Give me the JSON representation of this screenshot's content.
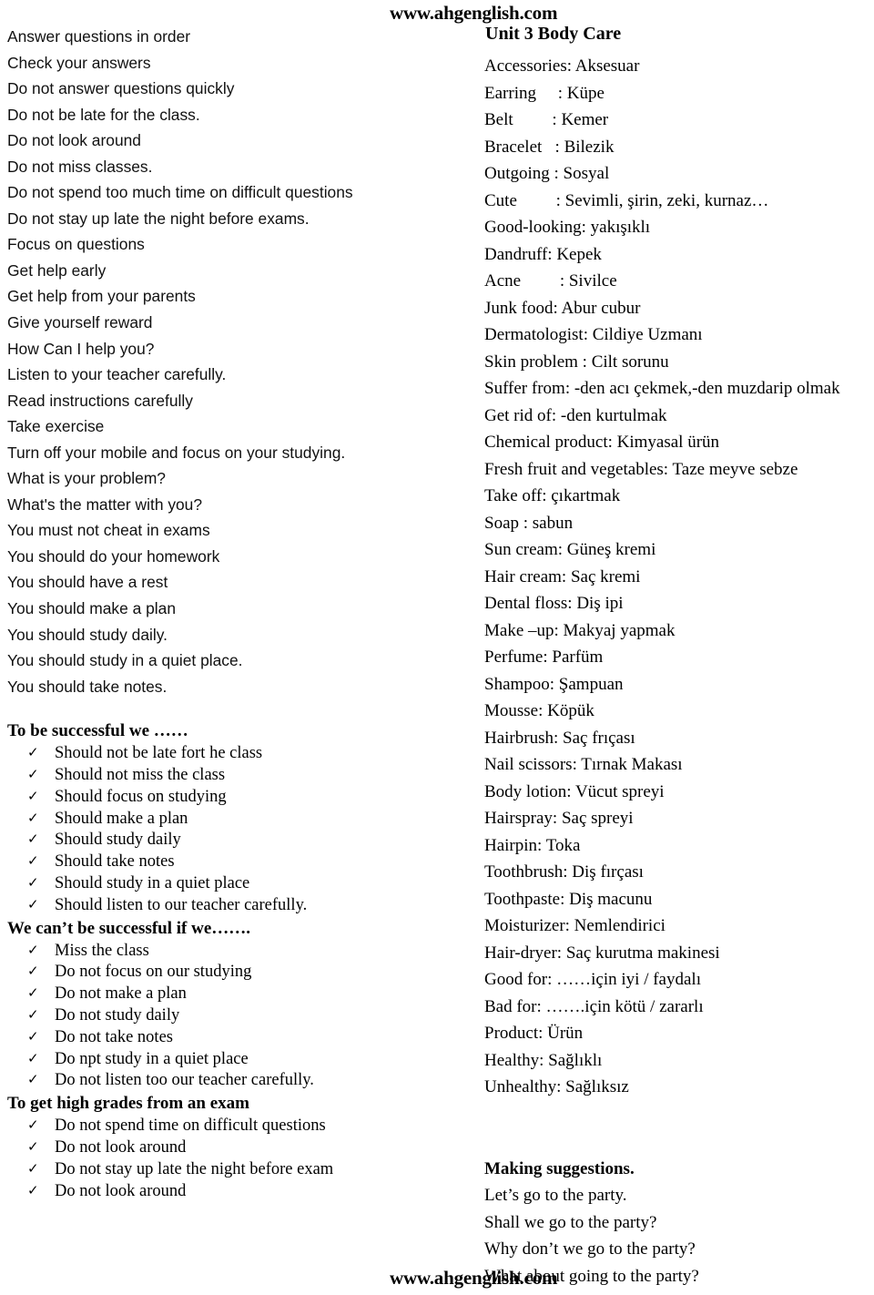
{
  "header": {
    "site_url": "www.ahgenglish.com",
    "unit_title": "Unit 3 Body Care"
  },
  "footer": {
    "site_url": "www.ahgenglish.com"
  },
  "left_column": {
    "phrase_lines": [
      "Answer questions in order",
      "Check your answers",
      "Do not answer questions quickly",
      "Do not be late for the class.",
      "Do not look around",
      "Do not miss classes.",
      "Do not spend too much time on difficult questions",
      "Do not stay up late the night before exams.",
      "Focus on questions",
      "Get help early",
      "Get help from your parents",
      "Give yourself reward",
      "How Can I help you?",
      "Listen to your teacher carefully.",
      "Read instructions carefully",
      "Take exercise",
      "Turn off your mobile and focus on your studying.",
      "What is your problem?",
      "What's the matter with you?",
      "You must not cheat in exams",
      "You should do your homework",
      "You should have a rest",
      "You should make a plan",
      "You should study daily.",
      "You should study in a quiet place.",
      "You should take notes."
    ],
    "sections": [
      {
        "heading": "To be successful we ……",
        "items": [
          "Should not be late fort he class",
          "Should not miss the class",
          "Should focus on studying",
          "Should make a plan",
          "Should study daily",
          "Should take notes",
          "Should study in a quiet place",
          "Should listen to our teacher carefully."
        ]
      },
      {
        "heading": "We can’t be successful if we…….",
        "items": [
          "Miss the class",
          "Do not focus on our studying",
          "Do not make a plan",
          "Do not study daily",
          "Do not take notes",
          "Do npt study in a quiet place",
          "Do not listen too our teacher carefully."
        ]
      },
      {
        "heading": "To get high grades from an exam",
        "items": [
          "Do not spend time on difficult questions",
          "Do not look around",
          "Do not stay up late the night before exam",
          "Do not look around"
        ]
      }
    ],
    "tick_glyph": "✓"
  },
  "right_column": {
    "vocabulary": [
      "Accessories: Aksesuar",
      "Earring  : Küpe",
      "Belt   : Kemer",
      "Bracelet  : Bilezik",
      "Outgoing  : Sosyal",
      "Cute   : Sevimli, şirin, zeki, kurnaz…",
      "Good-looking: yakışıklı",
      "Dandruff: Kepek",
      "Acne   : Sivilce",
      "Junk food: Abur cubur",
      "Dermatologist: Cildiye Uzmanı",
      "Skin problem : Cilt sorunu",
      "Suffer from: -den acı çekmek,-den muzdarip olmak",
      "Get rid of: -den kurtulmak",
      "Chemical product: Kimyasal ürün",
      "Fresh fruit and vegetables: Taze meyve sebze",
      "Take off: çıkartmak",
      "Soap : sabun",
      "Sun cream: Güneş kremi",
      "Hair cream: Saç kremi",
      "Dental floss: Diş ipi",
      "Make –up: Makyaj yapmak",
      "Perfume: Parfüm",
      "Shampoo: Şampuan",
      "Mousse: Köpük",
      "Hairbrush: Saç frıçası",
      "Nail scissors: Tırnak Makası",
      "Body lotion: Vücut spreyi",
      "Hairspray: Saç spreyi",
      "Hairpin: Toka",
      "Toothbrush: Diş fırçası",
      "Toothpaste: Diş macunu",
      "Moisturizer: Nemlendirici",
      "Hair-dryer: Saç kurutma makinesi",
      "Good for:  ……için iyi / faydalı",
      "Bad for:  …….için kötü / zararlı",
      "Product: Ürün",
      "Healthy: Sağlıklı",
      "Unhealthy: Sağlıksız"
    ],
    "suggestions_heading": "Making suggestions.",
    "suggestions": [
      "Let’s go to the party.",
      "Shall we go to the party?",
      "Why don’t we go to the party?",
      "What about going to the party?"
    ]
  }
}
